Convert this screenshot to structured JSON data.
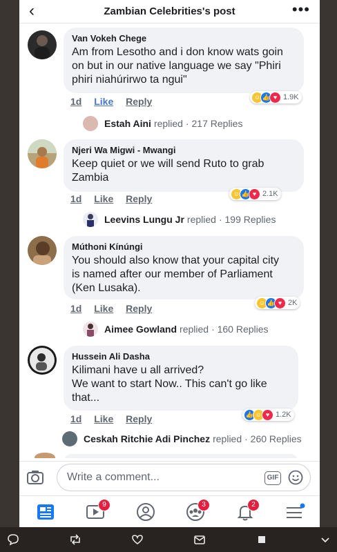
{
  "header": {
    "title": "Zambian Celebrities's post"
  },
  "comments": [
    {
      "author": "Van Vokeh Chege",
      "lines": [
        "Am from Lesotho and i don know wats goin",
        "on but in our native language we say \"Phiri",
        "phiri niahúrirwo ta ngui\""
      ],
      "time": "1d",
      "like": "Like",
      "reply": "Reply",
      "reactions": "1.9K",
      "replier": "Estah Aini",
      "replied": "replied",
      "replies": "· 217 Replies"
    },
    {
      "author": "Njeri Wa Migwi - Mwangi",
      "lines": [
        "Keep quiet or we will send Ruto to grab",
        "Zambia"
      ],
      "time": "1d",
      "like": "Like",
      "reply": "Reply",
      "reactions": "2.1K",
      "replier": "Leevins Lungu Jr",
      "replied": "replied",
      "replies": "· 199 Replies"
    },
    {
      "author": "Múthoni Kínúngi",
      "lines": [
        "You should also know that your capital city",
        "is named after our member of Parliament",
        "(Ken Lusaka)."
      ],
      "time": "1d",
      "like": "Like",
      "reply": "Reply",
      "reactions": "2K",
      "replier": "Aimee Gowland",
      "replied": "replied",
      "replies": "· 160 Replies"
    },
    {
      "author": "Hussein Ali Dasha",
      "lines": [
        "Kilimani  have u all arrived?",
        "We  want to start Now.. This  can't  go like",
        "that..."
      ],
      "time": "1d",
      "like": "Like",
      "reply": "Reply",
      "reactions": "1.2K",
      "replier": "Ceskah Ritchie Adi Pinchez",
      "replied": "replied",
      "replies": "· 260 Replies"
    }
  ],
  "composer": {
    "placeholder": "Write a comment...",
    "gif": "GIF"
  },
  "tabs": {
    "watch_badge": "9",
    "groups_badge": "3",
    "notifications_badge": "2"
  },
  "colors": {
    "accent": "#1877f2",
    "badge": "#e41e3f"
  }
}
